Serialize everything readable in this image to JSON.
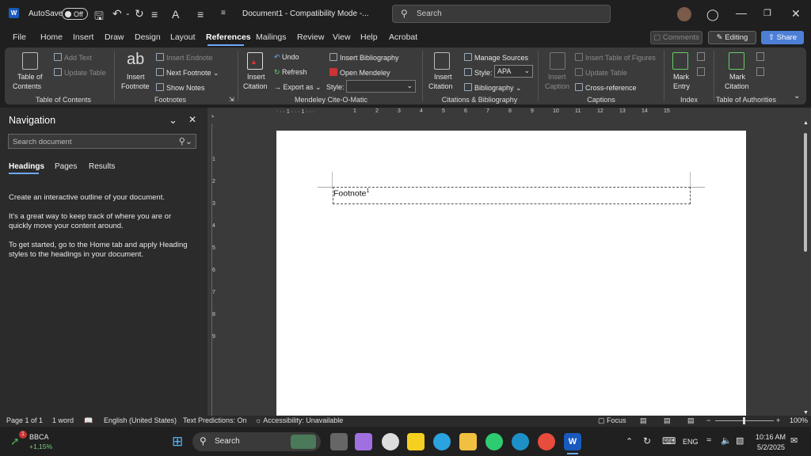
{
  "titlebar": {
    "autosave_label": "AutoSave",
    "autosave_state": "Off",
    "doc_title": "Document1  -  Compatibility Mode  -...",
    "search_placeholder": "Search"
  },
  "tabs": [
    "File",
    "Home",
    "Insert",
    "Draw",
    "Design",
    "Layout",
    "References",
    "Mailings",
    "Review",
    "View",
    "Help",
    "Acrobat"
  ],
  "active_tab": "References",
  "right_buttons": {
    "comments": "Comments",
    "editing": "Editing",
    "share": "Share"
  },
  "ribbon": {
    "toc": {
      "big": "Table of",
      "big2": "Contents",
      "add_text": "Add Text",
      "update_table": "Update Table",
      "group": "Table of Contents"
    },
    "footnotes": {
      "ab": "ab",
      "insert": "Insert",
      "insert2": "Footnote",
      "insert_endnote": "Insert Endnote",
      "next_footnote": "Next Footnote",
      "show_notes": "Show Notes",
      "group": "Footnotes"
    },
    "mendeley": {
      "insert": "Insert",
      "insert2": "Citation",
      "undo": "Undo",
      "refresh": "Refresh",
      "export": "Export as",
      "insert_bib": "Insert Bibliography",
      "open_mendeley": "Open Mendeley",
      "style_label": "Style:",
      "group": "Mendeley Cite-O-Matic"
    },
    "citations": {
      "insert": "Insert",
      "insert2": "Citation",
      "manage": "Manage Sources",
      "style_label": "Style:",
      "style_value": "APA",
      "bibliography": "Bibliography",
      "group": "Citations & Bibliography"
    },
    "captions": {
      "insert": "Insert",
      "insert2": "Caption",
      "insert_tof": "Insert Table of Figures",
      "update_table": "Update Table",
      "cross_ref": "Cross-reference",
      "group": "Captions"
    },
    "index": {
      "mark": "Mark",
      "mark2": "Entry",
      "group": "Index"
    },
    "toa": {
      "mark": "Mark",
      "mark2": "Citation",
      "group": "Table of Authorities"
    }
  },
  "nav": {
    "title": "Navigation",
    "search_placeholder": "Search document",
    "tabs": [
      "Headings",
      "Pages",
      "Results"
    ],
    "p1": "Create an interactive outline of your document.",
    "p2": "It's a great way to keep track of where you are or quickly move your content around.",
    "p3": "To get started, go to the Home tab and apply Heading styles to the headings in your document."
  },
  "ruler": {
    "ticks": [
      "1",
      "2",
      "3",
      "4",
      "5",
      "6",
      "7",
      "8",
      "9",
      "10",
      "11",
      "12",
      "13",
      "14",
      "15"
    ],
    "vticks": [
      "1",
      "2",
      "3",
      "4",
      "5",
      "6",
      "7",
      "8",
      "9"
    ]
  },
  "document": {
    "footnote_text": "Footnote",
    "footnote_mark": "1"
  },
  "status": {
    "page": "Page 1 of 1",
    "words": "1 word",
    "language": "English (United States)",
    "predictions": "Text Predictions: On",
    "accessibility": "Accessibility: Unavailable",
    "focus": "Focus",
    "zoom": "100%"
  },
  "taskbar": {
    "stock_name": "BBCA",
    "stock_change": "+1,15%",
    "stock_badge": "1",
    "search": "Search",
    "lang": "ENG",
    "time": "10:16 AM",
    "date": "5/2/2025"
  }
}
